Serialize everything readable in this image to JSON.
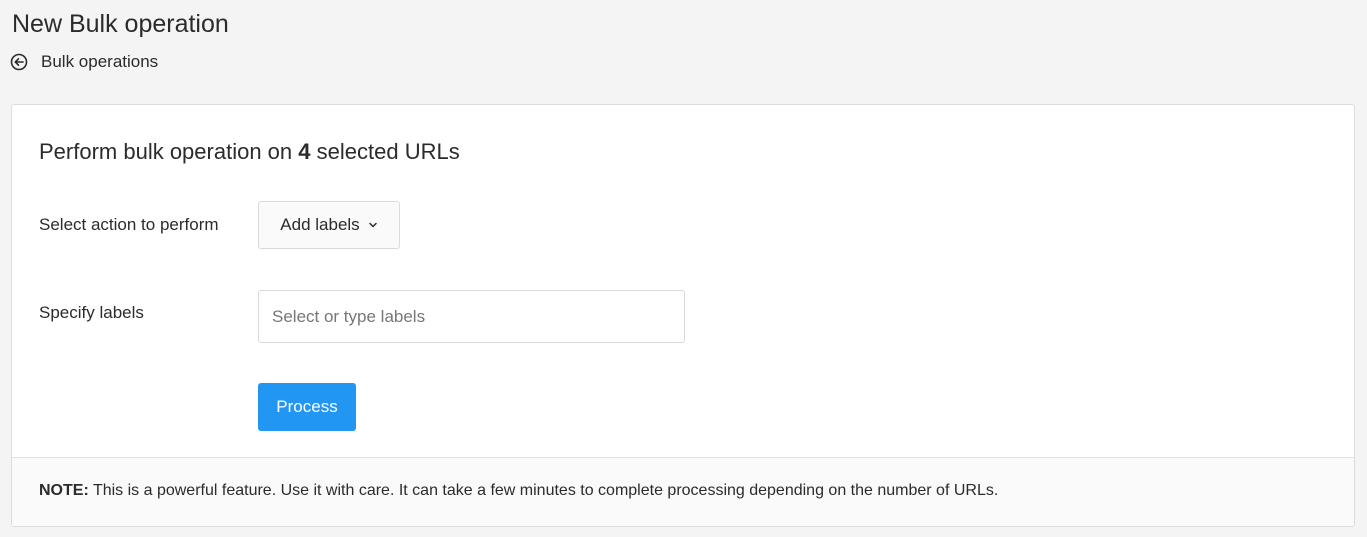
{
  "header": {
    "title": "New Bulk operation",
    "back_label": "Bulk operations"
  },
  "card": {
    "heading_prefix": "Perform bulk operation on",
    "selected_count": "4",
    "heading_suffix": "selected URLs",
    "action_label": "Select action to perform",
    "action_selected": "Add labels",
    "specify_label": "Specify labels",
    "labels_input": {
      "value": "",
      "placeholder": "Select or type labels"
    },
    "process_label": "Process"
  },
  "footer": {
    "note_label": "NOTE:",
    "note_text": "This is a powerful feature. Use it with care. It can take a few minutes to complete processing depending on the number of URLs."
  },
  "icons": {
    "back": "arrow-left-circle-icon",
    "dropdown": "chevron-down-icon"
  },
  "colors": {
    "primary": "#2196f3",
    "background": "#f4f4f4"
  }
}
